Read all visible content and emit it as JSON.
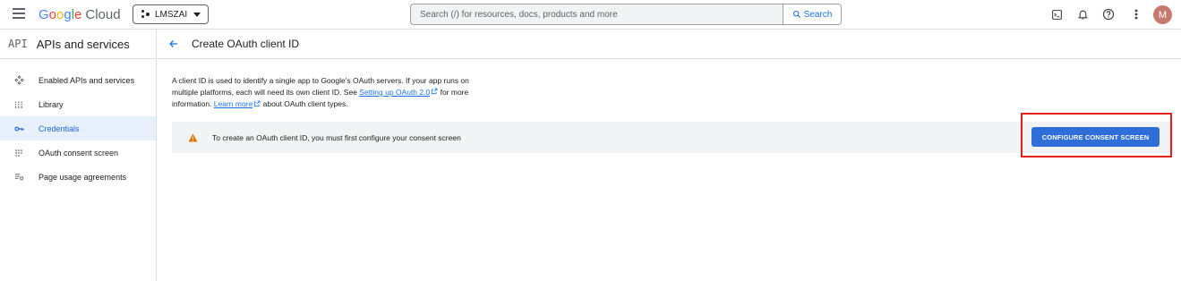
{
  "topbar": {
    "logo": {
      "g1": "G",
      "o1": "o",
      "o2": "o",
      "g2": "g",
      "l": "l",
      "e": "e",
      "product": "Cloud"
    },
    "project": {
      "name": "LMSZAI"
    },
    "search": {
      "placeholder": "Search (/) for resources, docs, products and more",
      "button_label": "Search"
    },
    "avatar_initial": "M",
    "icons": [
      "menu-icon",
      "cloud-shell-icon",
      "notifications-icon",
      "help-icon",
      "more-vert-icon"
    ]
  },
  "sidebar": {
    "logo_text": "API",
    "title": "APIs and services",
    "items": [
      {
        "label": "Enabled APIs and services",
        "icon": "enabled-apis-icon",
        "active": false
      },
      {
        "label": "Library",
        "icon": "library-icon",
        "active": false
      },
      {
        "label": "Credentials",
        "icon": "key-icon",
        "active": true
      },
      {
        "label": "OAuth consent screen",
        "icon": "consent-icon",
        "active": false
      },
      {
        "label": "Page usage agreements",
        "icon": "agreements-icon",
        "active": false
      }
    ]
  },
  "main": {
    "title": "Create OAuth client ID",
    "intro": {
      "line1": "A client ID is used to identify a single app to Google's OAuth servers. If your app runs on",
      "line2_pre": "multiple platforms, each will need its own client ID. See ",
      "link1": "Setting up OAuth 2.0",
      "line2_post": " for more",
      "line3_pre": "information. ",
      "link2": "Learn more",
      "line3_post": " about OAuth client types."
    },
    "banner": {
      "text": "To create an OAuth client ID, you must first configure your consent screen",
      "button_label": "CONFIGURE CONSENT SCREEN"
    }
  },
  "colors": {
    "accent": "#1a73e8",
    "button": "#2f6ed9",
    "warning": "#e37400",
    "highlight": "#e0201b",
    "avatar": "#c8796e"
  }
}
